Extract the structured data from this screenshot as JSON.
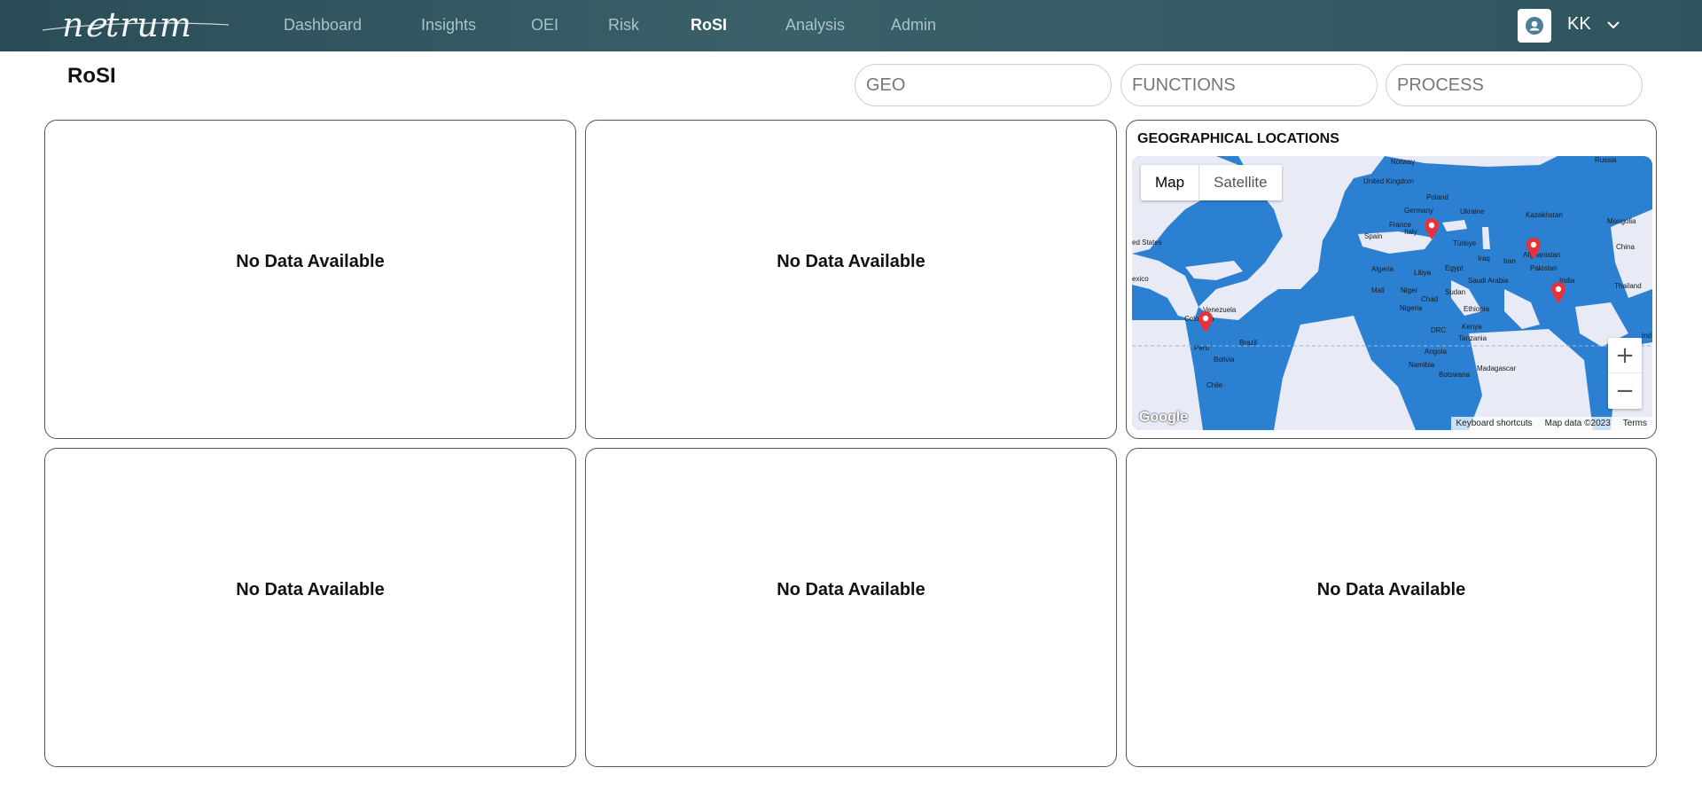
{
  "app": {
    "logo_text": "nℯtrum"
  },
  "nav": {
    "items": [
      {
        "label": "Dashboard"
      },
      {
        "label": "Insights"
      },
      {
        "label": "OEI"
      },
      {
        "label": "Risk"
      },
      {
        "label": "RoSI"
      },
      {
        "label": "Analysis"
      },
      {
        "label": "Admin"
      }
    ],
    "active": "RoSI"
  },
  "user": {
    "initials": "KK",
    "avatar_icon": "user-icon",
    "menu_icon": "chevron-down-icon"
  },
  "page": {
    "title": "RoSI"
  },
  "filters": {
    "geo_placeholder": "GEO",
    "functions_placeholder": "FUNCTIONS",
    "process_placeholder": "PROCESS"
  },
  "cards": {
    "no_data": "No Data Available"
  },
  "geo_card": {
    "title": "GEOGRAPHICAL LOCATIONS",
    "map_type_map": "Map",
    "map_type_satellite": "Satellite",
    "zoom_in": "+",
    "zoom_out": "−",
    "google": "Google",
    "keyboard_shortcuts": "Keyboard shortcuts",
    "map_data": "Map data ©2023",
    "terms": "Terms",
    "labels": {
      "norway": "Norway",
      "united_kingdom": "United Kingdom",
      "poland": "Poland",
      "germany": "Germany",
      "ukraine": "Ukraine",
      "kazakhstan": "Kazakhstan",
      "mongolia": "Mongolia",
      "france": "France",
      "italy": "Italy",
      "spain": "Spain",
      "turkiye": "Türkiye",
      "afghanistan": "Afghanistan",
      "china": "China",
      "united_states": "ed States",
      "iraq": "Iraq",
      "iran": "Iran",
      "algeria": "Algeria",
      "libya": "Libya",
      "egypt": "Egypt",
      "pakistan": "Pakistan",
      "saudi_arabia": "Saudi Arabia",
      "india": "India",
      "mexico": "exico",
      "mali": "Mali",
      "niger": "Niger",
      "sudan": "Sudan",
      "chad": "Chad",
      "thailand": "Thailand",
      "venezuela": "Venezuela",
      "nigeria": "Nigeria",
      "ethiopia": "Ethiopia",
      "colombia": "Colombia",
      "kenya": "Kenya",
      "drc": "DRC",
      "tanzania": "Tanzania",
      "peru": "Peru",
      "brazil": "Brazil",
      "angola": "Angola",
      "bolivia": "Bolivia",
      "namibia": "Namibia",
      "madagascar": "Madagascar",
      "botswana": "Botswana",
      "chile": "Chile",
      "russia": "Russia",
      "ind": "Ind"
    }
  },
  "colors": {
    "header_bg": "#2f5560",
    "nav_inactive": "#a9c3c6",
    "ocean": "#2b80d2",
    "land": "#e8eaf6",
    "pin": "#e8323a"
  }
}
